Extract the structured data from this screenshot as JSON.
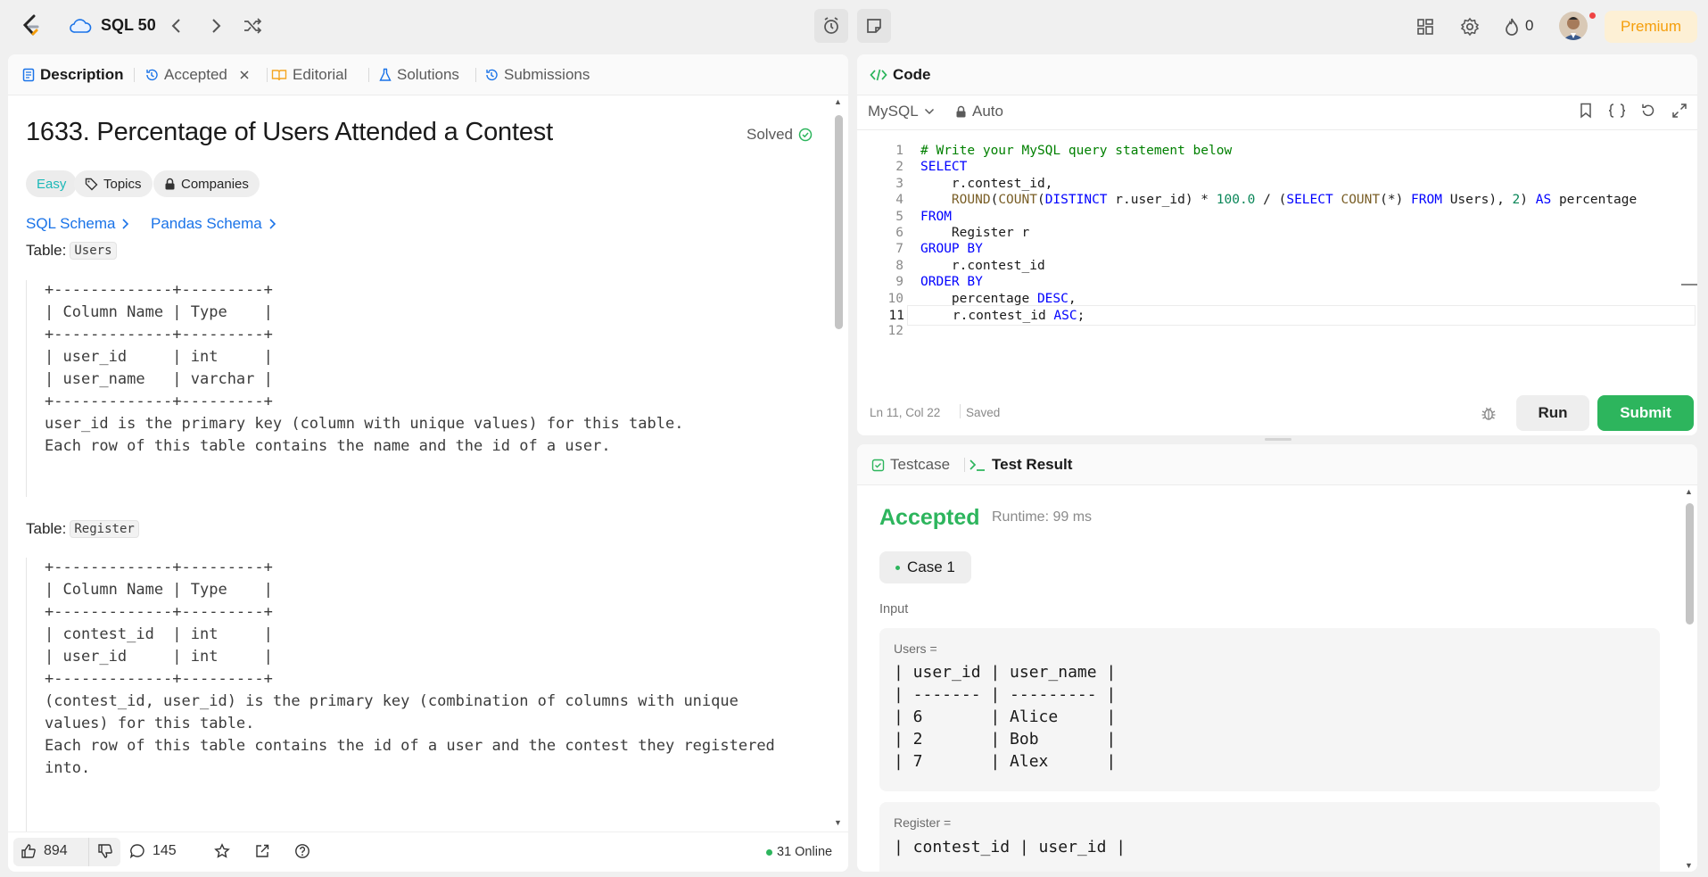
{
  "nav": {
    "title": "SQL 50",
    "streak_count": "0",
    "premium_label": "Premium"
  },
  "left_tabs": [
    {
      "label": "Description"
    },
    {
      "label": "Accepted"
    },
    {
      "label": "Editorial"
    },
    {
      "label": "Solutions"
    },
    {
      "label": "Submissions"
    }
  ],
  "problem": {
    "title": "1633. Percentage of Users Attended a Contest",
    "status": "Solved",
    "difficulty": "Easy",
    "topics_label": "Topics",
    "companies_label": "Companies",
    "sql_schema_label": "SQL Schema",
    "pandas_schema_label": "Pandas Schema",
    "table1_label": "Table:",
    "table1_name": "Users",
    "table1_text": "+-------------+---------+\n| Column Name | Type    |\n+-------------+---------+\n| user_id     | int     |\n| user_name   | varchar |\n+-------------+---------+\nuser_id is the primary key (column with unique values) for this table.\nEach row of this table contains the name and the id of a user.",
    "table2_label": "Table:",
    "table2_name": "Register",
    "table2_text": "+-------------+---------+\n| Column Name | Type    |\n+-------------+---------+\n| contest_id  | int     |\n| user_id     | int     |\n+-------------+---------+\n(contest_id, user_id) is the primary key (combination of columns with unique\nvalues) for this table.\nEach row of this table contains the id of a user and the contest they registered\ninto."
  },
  "footer": {
    "likes": "894",
    "comments": "145",
    "online": "31 Online"
  },
  "code_panel": {
    "title": "Code",
    "language": "MySQL",
    "mode": "Auto",
    "cursor_pos": "Ln 11, Col 22",
    "save_state": "Saved",
    "run_label": "Run",
    "submit_label": "Submit",
    "lines": [
      {
        "n": "1",
        "html": "<span class=\"cm\"># Write your MySQL query statement below</span>"
      },
      {
        "n": "2",
        "html": "<span class=\"kw\">SELECT</span>"
      },
      {
        "n": "3",
        "html": "    r.contest_id,"
      },
      {
        "n": "4",
        "html": "    <span class=\"fn\">ROUND</span>(<span class=\"fn\">COUNT</span>(<span class=\"kw\">DISTINCT</span> r.user_id) * <span class=\"nm\">100.0</span> / (<span class=\"kw\">SELECT</span> <span class=\"fn\">COUNT</span>(*) <span class=\"kw\">FROM</span> Users), <span class=\"nm\">2</span>) <span class=\"kw\">AS</span> percentage"
      },
      {
        "n": "5",
        "html": "<span class=\"kw\">FROM</span>"
      },
      {
        "n": "6",
        "html": "    Register r"
      },
      {
        "n": "7",
        "html": "<span class=\"kw\">GROUP BY</span>"
      },
      {
        "n": "8",
        "html": "    r.contest_id"
      },
      {
        "n": "9",
        "html": "<span class=\"kw\">ORDER BY</span>"
      },
      {
        "n": "10",
        "html": "    percentage <span class=\"kw\">DESC</span>,"
      },
      {
        "n": "11",
        "html": "    r.contest_id <span class=\"kw\">ASC</span>;"
      },
      {
        "n": "12",
        "html": ""
      }
    ]
  },
  "result_panel": {
    "tab_testcase": "Testcase",
    "tab_result": "Test Result",
    "verdict": "Accepted",
    "runtime": "Runtime: 99 ms",
    "case_label": "Case 1",
    "input_label": "Input",
    "users_label": "Users =",
    "users_table": "| user_id | user_name |\n| ------- | --------- |\n| 6       | Alice     |\n| 2       | Bob       |\n| 7       | Alex      |",
    "register_label": "Register =",
    "register_table": "| contest_id | user_id |"
  }
}
